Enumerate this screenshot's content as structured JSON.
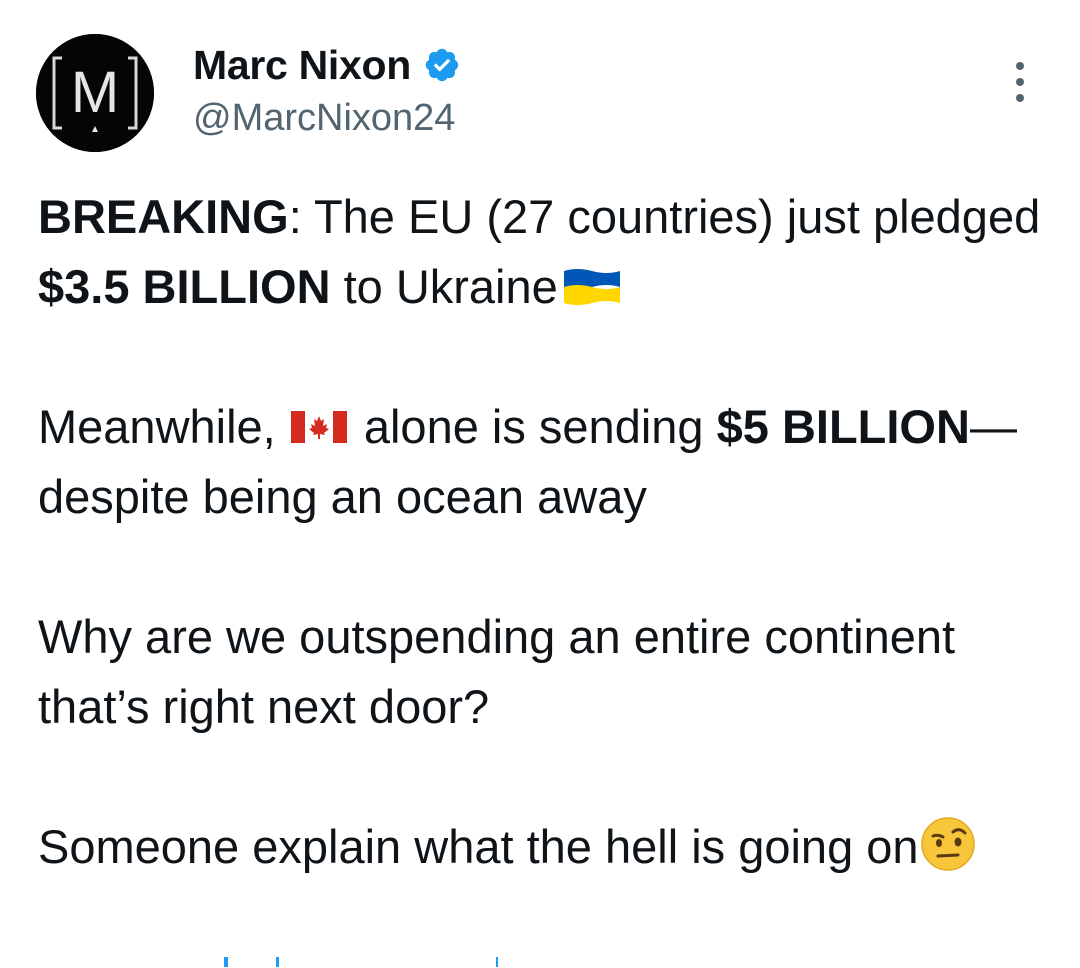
{
  "author": {
    "avatar_letter": "M",
    "display_name": "Marc Nixon",
    "handle": "@MarcNixon24",
    "verified_icon": "verified-badge-icon",
    "verified_color": "#1d9bf0"
  },
  "menu": {
    "icon": "more-options-icon"
  },
  "tweet": {
    "p1_bold1": "BREAKING",
    "p1_text1": ": The EU (27 countries) just pledged ",
    "p1_bold2": "$3.5 BILLION",
    "p1_text2": " to Ukraine",
    "p2_text1": "Meanwhile, ",
    "p2_text2": " alone is sending ",
    "p2_bold1": "$5 BILLION",
    "p2_text3": "—despite being an ocean away",
    "p3_text": "Why are we outspending an entire continent that’s right next door?",
    "p4_text": "Someone explain what the hell is going on"
  },
  "icons": {
    "ukraine_flag": "ukraine-flag-icon",
    "canada_flag": "canada-flag-icon",
    "emoji": "raised-eyebrow-emoji"
  },
  "colors": {
    "text": "#0f1419",
    "secondary": "#536471",
    "ukraine_blue": "#0057b7",
    "ukraine_yellow": "#ffd700",
    "canada_red": "#d52b1e"
  }
}
